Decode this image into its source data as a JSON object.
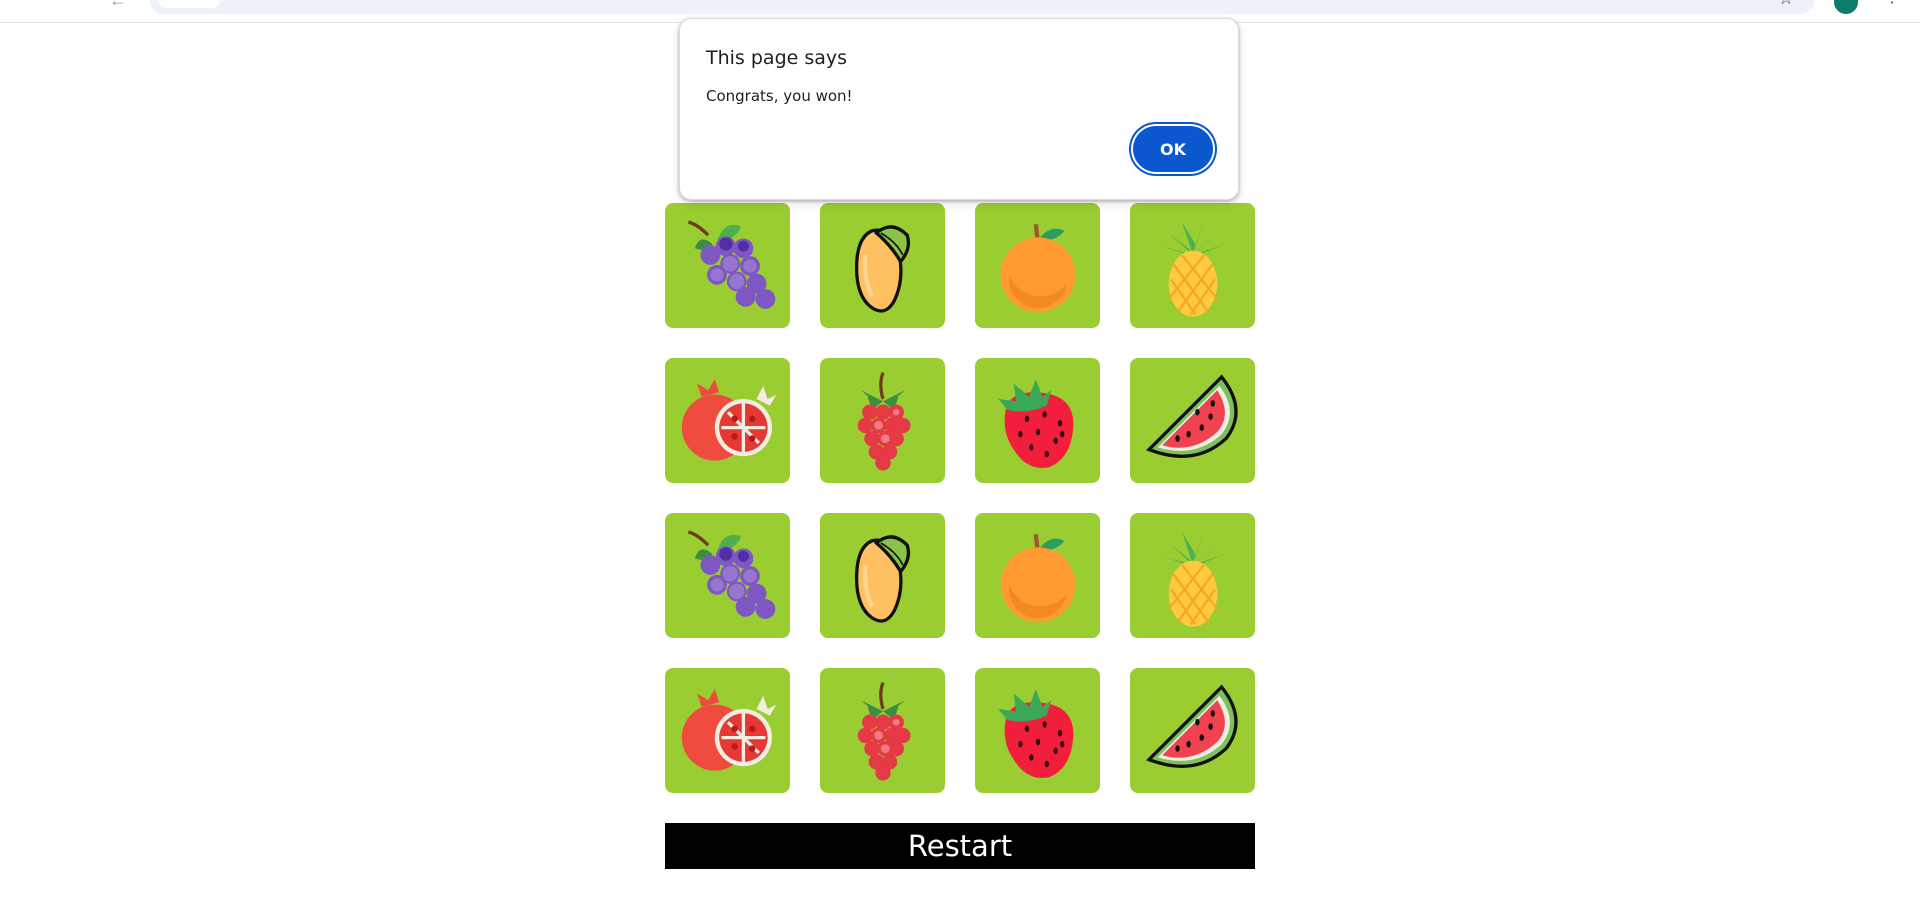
{
  "browser": {
    "back_icon": "back-arrow-icon",
    "star_icon": "bookmark-star-icon",
    "menu_icon": "kebab-menu-icon"
  },
  "alert": {
    "title": "This page says",
    "message": "Congrats, you won!",
    "ok_label": "OK",
    "button_color": "#0b57d0"
  },
  "game": {
    "card_color": "#9acd32",
    "grid": [
      [
        "grapes",
        "mango",
        "orange",
        "pineapple"
      ],
      [
        "pomegranate",
        "raspberry",
        "strawberry",
        "watermelon"
      ],
      [
        "grapes",
        "mango",
        "orange",
        "pineapple"
      ],
      [
        "pomegranate",
        "raspberry",
        "strawberry",
        "watermelon"
      ]
    ]
  },
  "restart_label": "Restart"
}
